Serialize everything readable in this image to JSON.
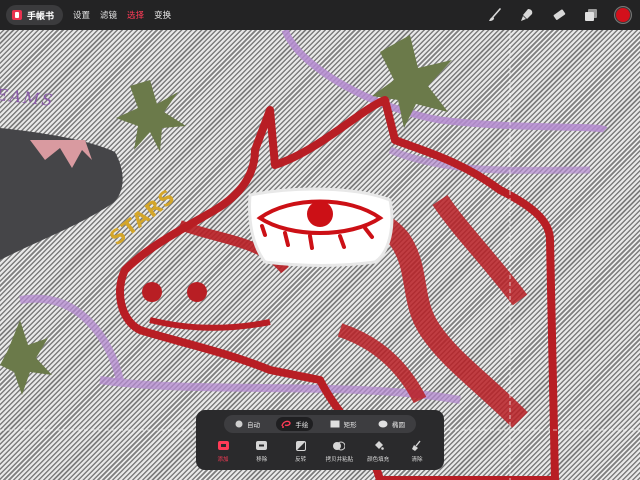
{
  "app": {
    "name": "手帳书"
  },
  "menu": {
    "items": [
      {
        "label": "设置"
      },
      {
        "label": "滤镜"
      },
      {
        "label": "选择"
      },
      {
        "label": "变换"
      }
    ]
  },
  "canvas_text": {
    "dreams": "EAMS",
    "stars": "STARS"
  },
  "selection_panel": {
    "modes": [
      {
        "label": "自动"
      },
      {
        "label": "手绘"
      },
      {
        "label": "矩形"
      },
      {
        "label": "椭圆"
      }
    ],
    "actions": [
      {
        "label": "添加"
      },
      {
        "label": "移除"
      },
      {
        "label": "反转"
      },
      {
        "label": "拷贝并粘贴"
      },
      {
        "label": "颜色填充"
      },
      {
        "label": "清除"
      }
    ]
  },
  "colors": {
    "accent": "#ff3b57",
    "current_color": "#d3101b",
    "toolbar_bg": "#232324"
  }
}
